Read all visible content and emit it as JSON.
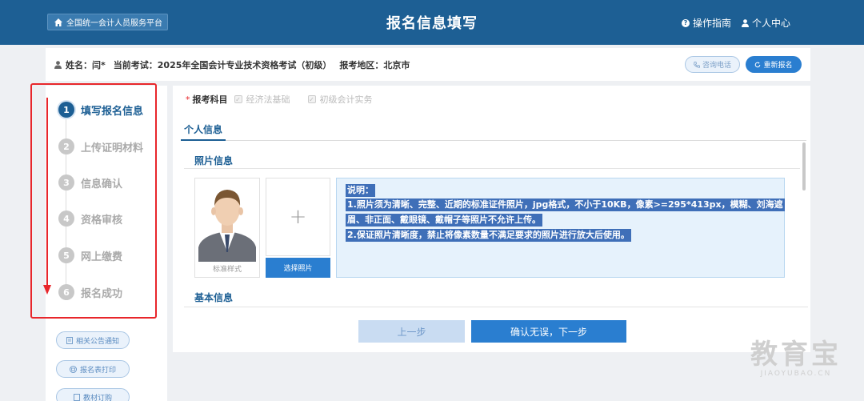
{
  "header": {
    "platform_button": "全国统一会计人员服务平台",
    "title": "报名信息填写",
    "guide_link": "操作指南",
    "user_center_link": "个人中心"
  },
  "infobar": {
    "name": "姓名：闫*",
    "exam": "当前考试：2025年全国会计专业技术资格考试（初级）",
    "region": "报考地区：北京市",
    "consult_button": "咨询电话",
    "reapply_button": "重新报名"
  },
  "steps": [
    {
      "num": "1",
      "label": "填写报名信息",
      "active": true
    },
    {
      "num": "2",
      "label": "上传证明材料",
      "active": false
    },
    {
      "num": "3",
      "label": "信息确认",
      "active": false
    },
    {
      "num": "4",
      "label": "资格审核",
      "active": false
    },
    {
      "num": "5",
      "label": "网上缴费",
      "active": false
    },
    {
      "num": "6",
      "label": "报名成功",
      "active": false
    }
  ],
  "side_links": {
    "notice": "相关公告通知",
    "print": "报名表打印",
    "books": "教材订购"
  },
  "subjects": {
    "required_mark": "*",
    "label": "报考科目",
    "options": [
      "经济法基础",
      "初级会计实务"
    ]
  },
  "tabs": {
    "personal": "个人信息"
  },
  "photo_section": {
    "title": "照片信息",
    "sample_caption": "标准样式",
    "upload_plus": "+",
    "choose_button": "选择照片",
    "notes": [
      "说明：",
      "1.照片须为清晰、完整、近期的标准证件照片，jpg格式，不小于10KB，像素>=295*413px，模糊、刘海遮",
      "眉、非正面、戴眼镜、戴帽子等照片不允许上传。",
      "2.保证照片清晰度，禁止将像素数量不满足要求的照片进行放大后使用。"
    ]
  },
  "basic_section": {
    "title": "基本信息"
  },
  "actions": {
    "prev": "上一步",
    "next": "确认无误，下一步"
  },
  "watermark": {
    "main": "教育宝",
    "sub": "JIAOYUBAO.CN"
  },
  "colors": {
    "header": "#1d5f94",
    "accent": "#2a7ed0",
    "annotation": "#e8262b"
  }
}
